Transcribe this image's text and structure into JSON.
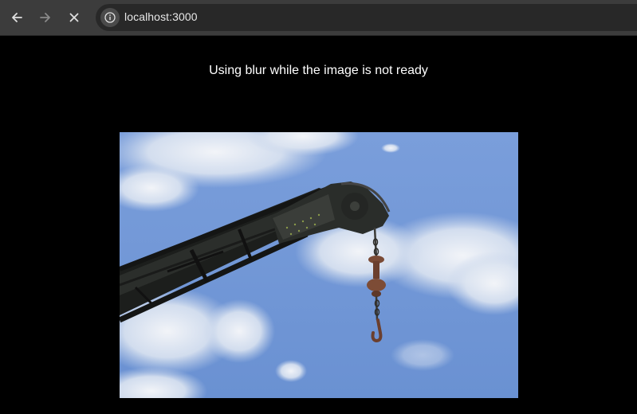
{
  "browser": {
    "url": "localhost:3000",
    "icons": {
      "back": "arrow-left-icon",
      "forward": "arrow-right-icon",
      "stop": "close-icon",
      "site_info": "info-icon"
    }
  },
  "page": {
    "heading": "Using blur while the image is not ready",
    "image": {
      "subject": "crane-arm-with-hook-against-sky"
    }
  },
  "colors": {
    "toolbar": "#3c3c3c",
    "omnibox": "#282828",
    "page_background": "#000000",
    "sky": "#6f95d4"
  }
}
